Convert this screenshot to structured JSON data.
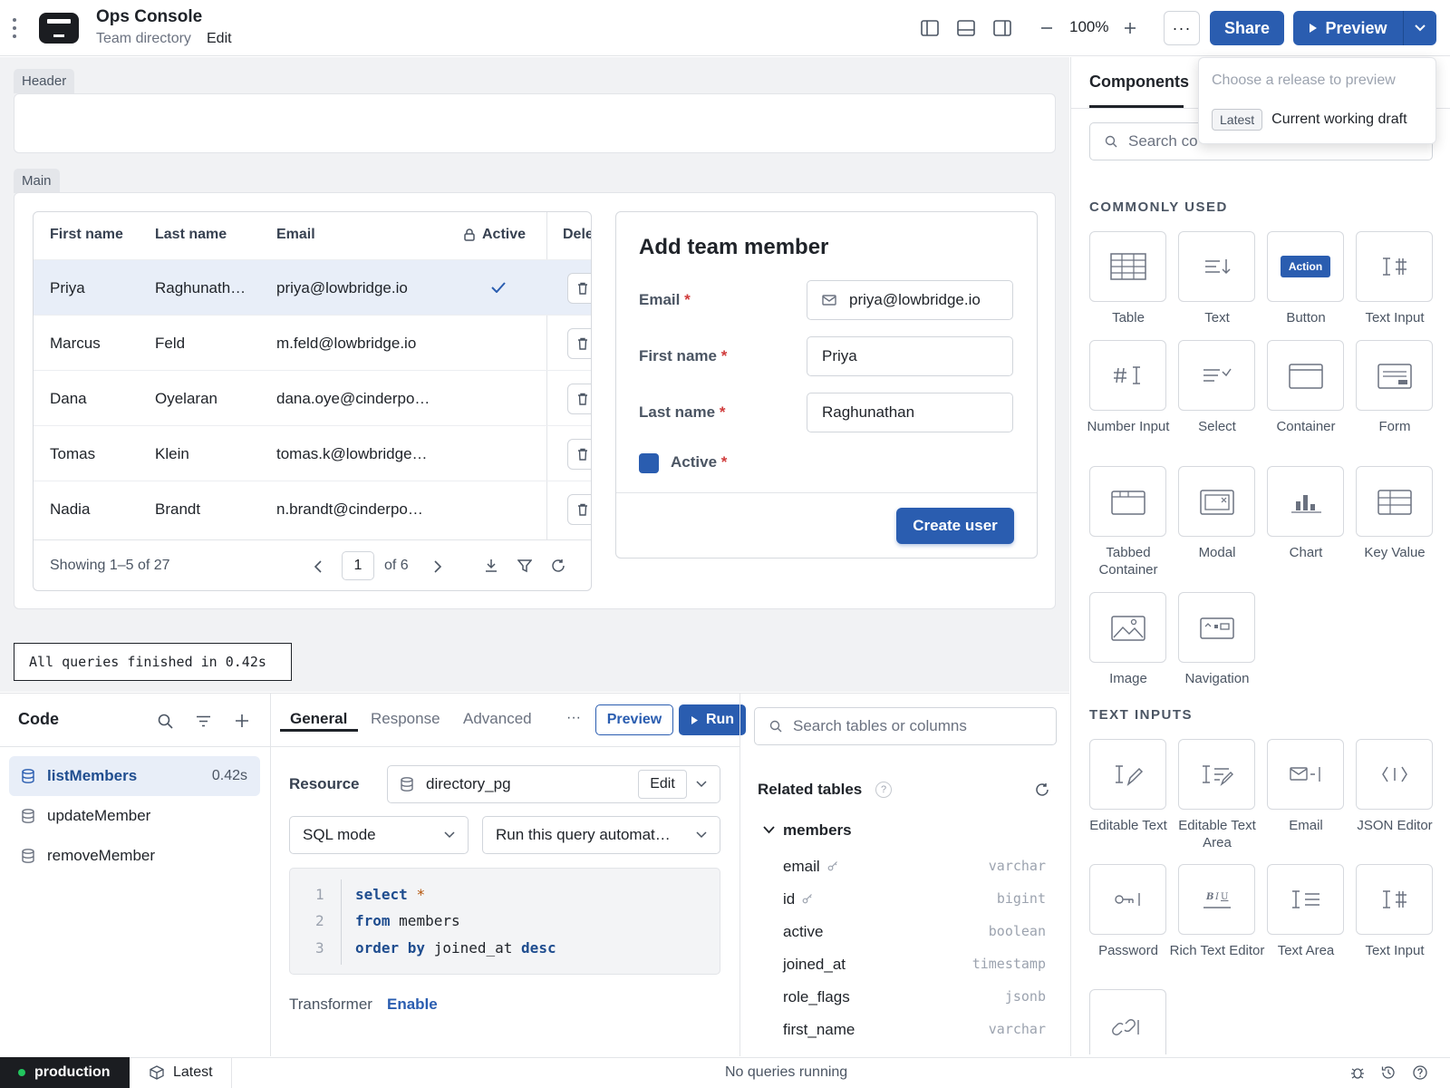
{
  "app": {
    "title": "Ops Console",
    "page": "Team directory",
    "edit_label": "Edit"
  },
  "toolbar": {
    "zoom": "100%",
    "more": "···",
    "share": "Share",
    "preview": "Preview"
  },
  "preview_popover": {
    "placeholder": "Choose a release to preview",
    "tag": "Latest",
    "option": "Current working draft"
  },
  "canvas": {
    "header_label": "Header",
    "main_label": "Main"
  },
  "table": {
    "columns": [
      "First name",
      "Last name",
      "Email",
      "Active",
      "Dele"
    ],
    "rows": [
      {
        "first": "Priya",
        "last": "Raghunath…",
        "email": "priya@lowbridge.io",
        "active": true
      },
      {
        "first": "Marcus",
        "last": "Feld",
        "email": "m.feld@lowbridge.io",
        "active": false
      },
      {
        "first": "Dana",
        "last": "Oyelaran",
        "email": "dana.oye@cinderpo…",
        "active": false
      },
      {
        "first": "Tomas",
        "last": "Klein",
        "email": "tomas.k@lowbridge…",
        "active": false
      },
      {
        "first": "Nadia",
        "last": "Brandt",
        "email": "n.brandt@cinderpo…",
        "active": false
      }
    ],
    "footer": {
      "showing": "Showing 1–5 of 27",
      "page": "1",
      "of": "of 6"
    }
  },
  "form": {
    "title": "Add team member",
    "email_label": "Email",
    "email_value": "priya@lowbridge.io",
    "first_label": "First name",
    "first_value": "Priya",
    "last_label": "Last name",
    "last_value": "Raghunathan",
    "active_label": "Active",
    "required_mark": "*",
    "submit": "Create user"
  },
  "toast": "All queries finished in 0.42s",
  "code_panel": {
    "title": "Code",
    "queries": [
      {
        "name": "listMembers",
        "time": "0.42s"
      },
      {
        "name": "updateMember",
        "time": ""
      },
      {
        "name": "removeMember",
        "time": ""
      }
    ]
  },
  "query_editor": {
    "tabs": [
      "General",
      "Response",
      "Advanced"
    ],
    "more": "···",
    "preview": "Preview",
    "run": "Run",
    "resource_label": "Resource",
    "resource": "directory_pg",
    "resource_edit": "Edit",
    "mode": "SQL mode",
    "trigger": "Run this query automat…",
    "code": {
      "l1_kw": "select",
      "l1_op": "*",
      "l2_kw": "from",
      "l2_rest": "members",
      "l3_kw": "order by",
      "l3_rest": "joined_at",
      "l3_kw2": "desc"
    },
    "line_numbers": [
      "1",
      "2",
      "3"
    ],
    "transformer_label": "Transformer",
    "transformer_action": "Enable"
  },
  "schema": {
    "search_placeholder": "Search tables or columns",
    "related_title": "Related tables",
    "help": "?",
    "table": "members",
    "columns": [
      {
        "name": "email",
        "type": "varchar",
        "key": true
      },
      {
        "name": "id",
        "type": "bigint",
        "key": true
      },
      {
        "name": "active",
        "type": "boolean",
        "key": false
      },
      {
        "name": "joined_at",
        "type": "timestamp",
        "key": false
      },
      {
        "name": "role_flags",
        "type": "jsonb",
        "key": false
      },
      {
        "name": "first_name",
        "type": "varchar",
        "key": false
      }
    ]
  },
  "components": {
    "tab": "Components",
    "search_placeholder": "Search co",
    "group1": "COMMONLY USED",
    "group2": "TEXT INPUTS",
    "button_badge": "Action",
    "common": [
      "Table",
      "Text",
      "Button",
      "Text Input",
      "Number Input",
      "Select",
      "Container",
      "Form",
      "Tabbed Container",
      "Modal",
      "Chart",
      "Key Value",
      "Image",
      "Navigation"
    ],
    "text_inputs": [
      "Editable Text",
      "Editable Text Area",
      "Email",
      "JSON Editor",
      "Password",
      "Rich Text Editor",
      "Text Area",
      "Text Input"
    ]
  },
  "status": {
    "env": "production",
    "release": "Latest",
    "queries": "No queries running"
  },
  "colors": {
    "accent": "#2a5db0",
    "env_dot": "#22c55e",
    "required": "#d03b3b"
  }
}
